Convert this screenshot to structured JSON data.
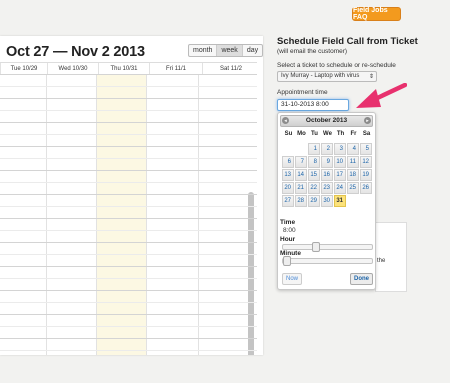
{
  "header": {
    "faq_button": "Field Jobs FAQ"
  },
  "calendar": {
    "title": "Oct 27 — Nov 2 2013",
    "views": [
      "month",
      "week",
      "day"
    ],
    "active_view": "week",
    "columns": [
      "Tue 10/29",
      "Wed 10/30",
      "Thu 10/31",
      "Fri 11/1",
      "Sat 11/2"
    ],
    "today_column": "Thu 10/31"
  },
  "schedule": {
    "title": "Schedule Field Call from Ticket",
    "subtitle": "(will email the customer)",
    "ticket_label": "Select a ticket to schedule or re-schedule",
    "ticket_value": "Ivy Murray - Laptop with virus",
    "appointment_label": "Appointment time",
    "appointment_value": "31-10-2013 8:00",
    "partial_text": "the"
  },
  "datepicker": {
    "month_title": "October 2013",
    "prev_icon": "chevron-left-icon",
    "next_icon": "chevron-right-icon",
    "weekdays": [
      "Su",
      "Mo",
      "Tu",
      "We",
      "Th",
      "Fr",
      "Sa"
    ],
    "weeks": [
      [
        "",
        "",
        "1",
        "2",
        "3",
        "4",
        "5"
      ],
      [
        "6",
        "7",
        "8",
        "9",
        "10",
        "11",
        "12"
      ],
      [
        "13",
        "14",
        "15",
        "16",
        "17",
        "18",
        "19"
      ],
      [
        "20",
        "21",
        "22",
        "23",
        "24",
        "25",
        "26"
      ],
      [
        "27",
        "28",
        "29",
        "30",
        "31",
        "",
        ""
      ]
    ],
    "selected_day": "31",
    "time_label": "Time",
    "time_value": "8:00",
    "hour_label": "Hour",
    "minute_label": "Minute",
    "hour_fraction": 0.35,
    "minute_fraction": 0.0,
    "now_button": "Now",
    "done_button": "Done"
  },
  "colors": {
    "accent": "#f39a1e",
    "today": "#fcf8e3",
    "selected_day": "#fce27a",
    "arrow": "#e8316e"
  }
}
